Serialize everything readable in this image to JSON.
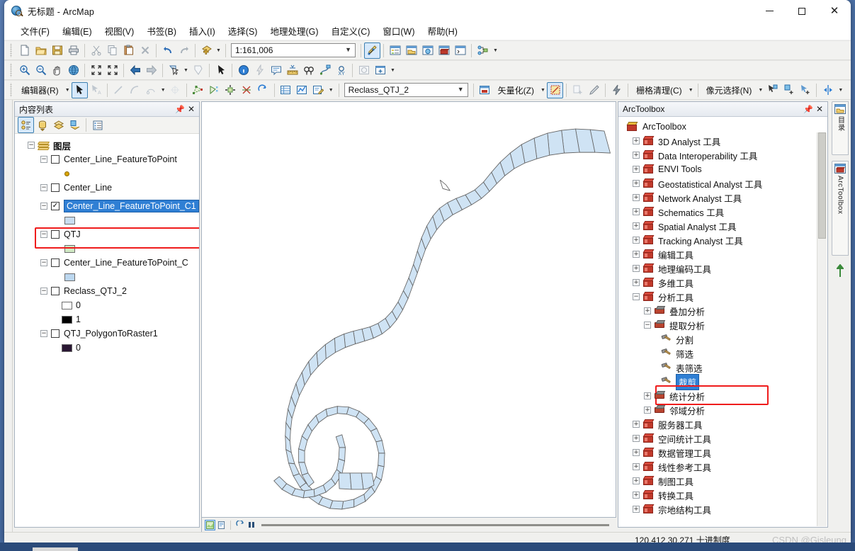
{
  "window": {
    "title": "无标题 - ArcMap",
    "app_icon": "arcmap-globe-icon",
    "minimize": "—",
    "maximize": "□",
    "close": "✕"
  },
  "menubar": {
    "items": [
      {
        "label": "文件(F)",
        "name": "menu-file"
      },
      {
        "label": "编辑(E)",
        "name": "menu-edit"
      },
      {
        "label": "视图(V)",
        "name": "menu-view"
      },
      {
        "label": "书签(B)",
        "name": "menu-bookmarks"
      },
      {
        "label": "插入(I)",
        "name": "menu-insert"
      },
      {
        "label": "选择(S)",
        "name": "menu-selection"
      },
      {
        "label": "地理处理(G)",
        "name": "menu-geoprocessing"
      },
      {
        "label": "自定义(C)",
        "name": "menu-customize"
      },
      {
        "label": "窗口(W)",
        "name": "menu-window"
      },
      {
        "label": "帮助(H)",
        "name": "menu-help"
      }
    ]
  },
  "standard_toolbar": {
    "scale": "1:161,006",
    "buttons": [
      "new-document-icon",
      "open-folder-icon",
      "save-icon",
      "print-icon",
      "cut-icon",
      "copy-icon",
      "paste-icon",
      "delete-x-icon",
      "undo-icon",
      "redo-icon",
      "add-data-icon"
    ],
    "right_buttons": [
      "editor-toolbar-icon",
      "table-of-contents-icon",
      "catalog-icon",
      "search-icon",
      "arctoolbox-icon",
      "python-window-icon",
      "modelbuilder-icon"
    ]
  },
  "tools_toolbar": {
    "buttons": [
      "zoom-in-icon",
      "zoom-out-icon",
      "pan-icon",
      "full-extent-icon",
      "fixed-zoom-in-icon",
      "fixed-zoom-out-icon",
      "go-back-icon",
      "go-forward-icon",
      "select-features-icon",
      "clear-selection-icon",
      "select-elements-icon",
      "identify-icon",
      "hyperlink-icon",
      "html-popup-icon",
      "measure-icon",
      "find-icon",
      "find-route-icon",
      "go-to-xy-icon",
      "time-slider-icon",
      "create-viewer-window-icon"
    ]
  },
  "editor_toolbar": {
    "editor_label": "编辑器(R)",
    "layer_combo_value": "Reclass_QTJ_2",
    "vectorize_label": "矢量化(Z)",
    "raster_cleanup_label": "栅格清理(C)",
    "pixel_select_label": "像元选择(N)"
  },
  "toc": {
    "title": "内容列表",
    "pin_icon": "pin-icon",
    "close_icon": "close-icon",
    "toolbar_buttons": [
      "list-by-drawing-order-icon",
      "list-by-source-icon",
      "list-by-visibility-icon",
      "list-by-selection-icon",
      "options-icon"
    ],
    "root": {
      "label": "图层",
      "icon": "layers-icon"
    },
    "layers": [
      {
        "label": "Center_Line_FeatureToPoint",
        "checked": false,
        "symbol_type": "point",
        "symbol_color": "#d9a400",
        "highlighted": false
      },
      {
        "label": "Center_Line",
        "checked": false,
        "symbol_type": "none",
        "symbol_color": "",
        "highlighted": false
      },
      {
        "label": "Center_Line_FeatureToPoint_C1",
        "checked": true,
        "symbol_type": "poly",
        "symbol_color": "#c9ddf0",
        "highlighted": true
      },
      {
        "label": "QTJ",
        "checked": false,
        "symbol_type": "poly",
        "symbol_color": "#cfeac4",
        "highlighted": false
      },
      {
        "label": "Center_Line_FeatureToPoint_C",
        "checked": false,
        "symbol_type": "poly",
        "symbol_color": "#bcd7ef",
        "highlighted": false
      },
      {
        "label": "Reclass_QTJ_2",
        "checked": false,
        "symbol_type": "classes",
        "highlighted": false,
        "classes": [
          {
            "value": "0",
            "color": "#ffffff"
          },
          {
            "value": "1",
            "color": "#000000"
          }
        ]
      },
      {
        "label": "QTJ_PolygonToRaster1",
        "checked": false,
        "symbol_type": "classes",
        "highlighted": false,
        "classes": [
          {
            "value": "0",
            "color": "#2a1733"
          }
        ]
      }
    ],
    "highlight_color": "#ef1c1c"
  },
  "map": {
    "background": "#ffffff",
    "feature_fill": "#cfe3f4",
    "feature_stroke": "#646464",
    "bottom_bar": {
      "data_view_icon": "data-view-icon",
      "layout_view_icon": "layout-view-icon",
      "refresh_icon": "refresh-icon",
      "pause_icon": "pause-drawing-icon"
    }
  },
  "arctoolbox": {
    "title": "ArcToolbox",
    "pin_icon": "pin-icon",
    "close_icon": "close-icon",
    "root": {
      "label": "ArcToolbox",
      "icon": "arctoolbox-root-icon"
    },
    "nodes": [
      {
        "label": "3D Analyst 工具",
        "depth": 1,
        "expander": "+",
        "icon": "toolbox-icon"
      },
      {
        "label": "Data Interoperability 工具",
        "depth": 1,
        "expander": "+",
        "icon": "toolbox-icon"
      },
      {
        "label": "ENVI Tools",
        "depth": 1,
        "expander": "+",
        "icon": "toolbox-icon"
      },
      {
        "label": "Geostatistical Analyst 工具",
        "depth": 1,
        "expander": "+",
        "icon": "toolbox-icon"
      },
      {
        "label": "Network Analyst 工具",
        "depth": 1,
        "expander": "+",
        "icon": "toolbox-icon"
      },
      {
        "label": "Schematics 工具",
        "depth": 1,
        "expander": "+",
        "icon": "toolbox-icon"
      },
      {
        "label": "Spatial Analyst 工具",
        "depth": 1,
        "expander": "+",
        "icon": "toolbox-icon"
      },
      {
        "label": "Tracking Analyst 工具",
        "depth": 1,
        "expander": "+",
        "icon": "toolbox-icon"
      },
      {
        "label": "编辑工具",
        "depth": 1,
        "expander": "+",
        "icon": "toolbox-icon"
      },
      {
        "label": "地理编码工具",
        "depth": 1,
        "expander": "+",
        "icon": "toolbox-icon"
      },
      {
        "label": "多维工具",
        "depth": 1,
        "expander": "+",
        "icon": "toolbox-icon"
      },
      {
        "label": "分析工具",
        "depth": 1,
        "expander": "-",
        "icon": "toolbox-icon"
      },
      {
        "label": "叠加分析",
        "depth": 2,
        "expander": "+",
        "icon": "toolset-icon"
      },
      {
        "label": "提取分析",
        "depth": 2,
        "expander": "-",
        "icon": "toolset-icon"
      },
      {
        "label": "分割",
        "depth": 3,
        "expander": "",
        "icon": "tool-icon"
      },
      {
        "label": "筛选",
        "depth": 3,
        "expander": "",
        "icon": "tool-icon"
      },
      {
        "label": "表筛选",
        "depth": 3,
        "expander": "",
        "icon": "tool-icon"
      },
      {
        "label": "裁剪",
        "depth": 3,
        "expander": "",
        "icon": "tool-icon",
        "selected": true,
        "highlighted": true
      },
      {
        "label": "统计分析",
        "depth": 2,
        "expander": "+",
        "icon": "toolset-icon"
      },
      {
        "label": "邻域分析",
        "depth": 2,
        "expander": "+",
        "icon": "toolset-icon"
      },
      {
        "label": "服务器工具",
        "depth": 1,
        "expander": "+",
        "icon": "toolbox-icon"
      },
      {
        "label": "空间统计工具",
        "depth": 1,
        "expander": "+",
        "icon": "toolbox-icon"
      },
      {
        "label": "数据管理工具",
        "depth": 1,
        "expander": "+",
        "icon": "toolbox-icon"
      },
      {
        "label": "线性参考工具",
        "depth": 1,
        "expander": "+",
        "icon": "toolbox-icon"
      },
      {
        "label": "制图工具",
        "depth": 1,
        "expander": "+",
        "icon": "toolbox-icon"
      },
      {
        "label": "转换工具",
        "depth": 1,
        "expander": "+",
        "icon": "toolbox-icon"
      },
      {
        "label": "宗地结构工具",
        "depth": 1,
        "expander": "+",
        "icon": "toolbox-icon"
      }
    ],
    "selection_color": "#2f7fd4",
    "highlight_color": "#ef1c1c"
  },
  "side_tabs": [
    {
      "label": "目录",
      "icon": "catalog-icon"
    },
    {
      "label": "ArcToolbox",
      "icon": "arctoolbox-icon"
    }
  ],
  "statusbar": {
    "coordinates": "120.412  30.271  十进制度",
    "watermark": "CSDN @Gisleung"
  }
}
